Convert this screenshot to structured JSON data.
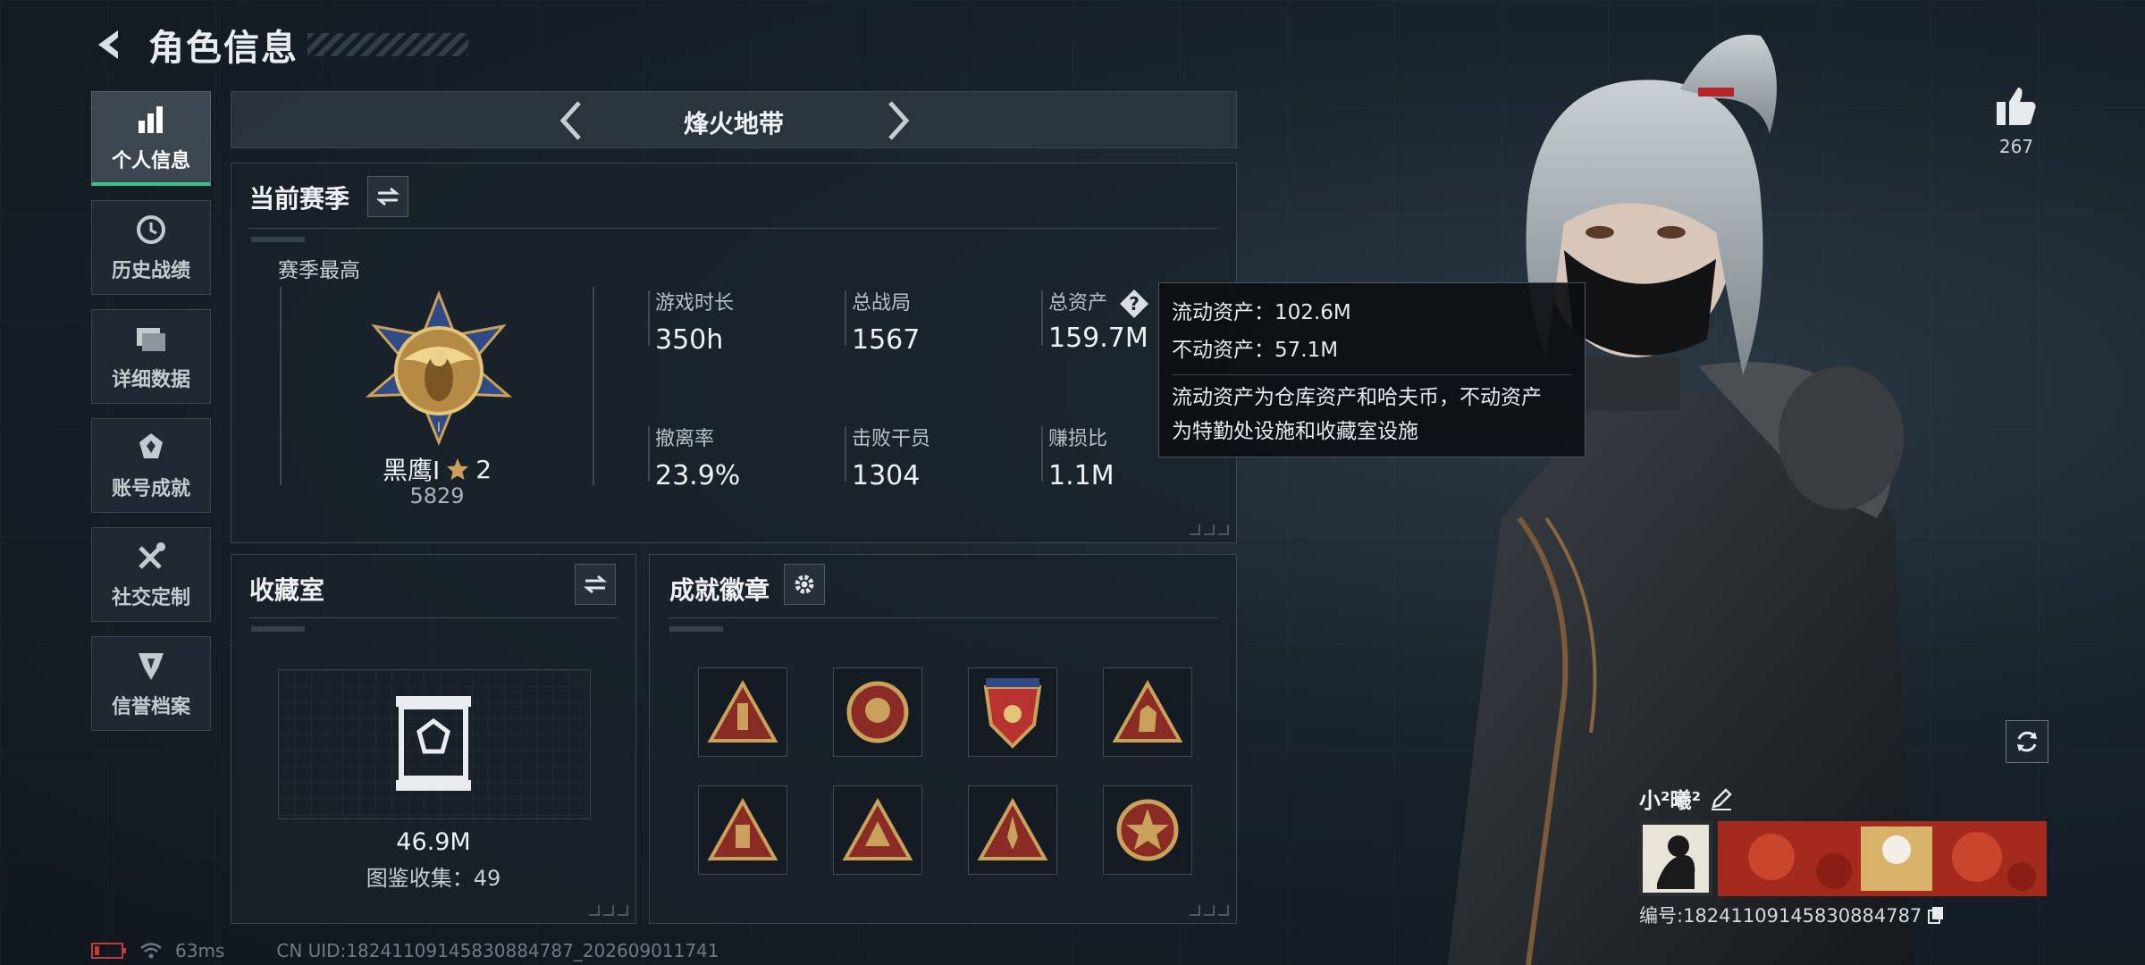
{
  "header": {
    "title": "角色信息"
  },
  "sidebar": {
    "items": [
      {
        "label": "个人信息"
      },
      {
        "label": "历史战绩"
      },
      {
        "label": "详细数据"
      },
      {
        "label": "账号成就"
      },
      {
        "label": "社交定制"
      },
      {
        "label": "信誉档案"
      }
    ]
  },
  "mode": {
    "name": "烽火地带"
  },
  "season": {
    "title": "当前赛季",
    "best_label": "赛季最高",
    "rank_name": "黑鹰I",
    "rank_stars": "2",
    "rank_score": "5829",
    "stats": [
      {
        "label": "游戏时长",
        "value": "350h"
      },
      {
        "label": "总战局",
        "value": "1567"
      },
      {
        "label": "总资产",
        "value": "159.7M"
      },
      {
        "label": "撤离率",
        "value": "23.9%"
      },
      {
        "label": "击败干员",
        "value": "1304"
      },
      {
        "label": "赚损比",
        "value": "1.1M"
      }
    ]
  },
  "tooltip": {
    "liquid": "流动资产：102.6M",
    "fixed": "不动资产：57.1M",
    "desc_line1": "流动资产为仓库资产和哈夫币，不动资产",
    "desc_line2": "为特勤处设施和收藏室设施"
  },
  "collection": {
    "title": "收藏室",
    "value": "46.9M",
    "codex": "图鉴收集：49"
  },
  "achievements": {
    "title": "成就徽章"
  },
  "likes": {
    "count": "267"
  },
  "player": {
    "name": "小²曦²",
    "id": "编号:18241109145830884787"
  },
  "status": {
    "ping": "63ms",
    "uid": "CN UID:18241109145830884787_202609011741"
  },
  "colors": {
    "accent": "#3ec28a",
    "gold": "#c9a15a",
    "badge_red": "#b8322f"
  }
}
